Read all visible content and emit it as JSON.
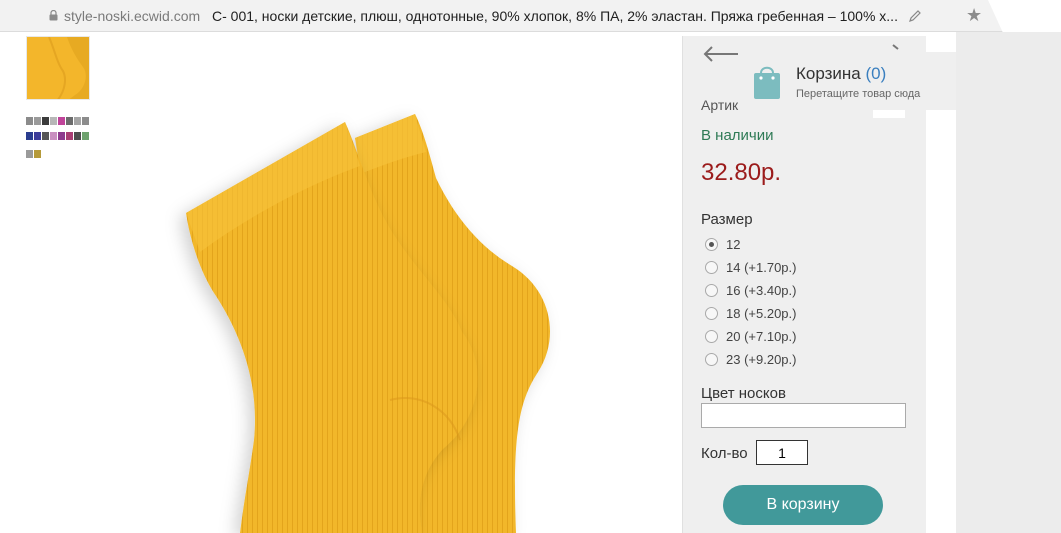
{
  "browser": {
    "url": "style-noski.ecwid.com",
    "page_title": "С- 001, носки детские, плюш, однотонные, 90% хлопок, 8% ПА, 2% эластан. Пряжа гребенная – 100% х..."
  },
  "product": {
    "article_label": "Артик",
    "stock": "В наличии",
    "price": "32.80р.",
    "size_label": "Размер",
    "sizes": [
      {
        "label": "12",
        "checked": true
      },
      {
        "label": "14 (+1.70р.)",
        "checked": false
      },
      {
        "label": "16 (+3.40р.)",
        "checked": false
      },
      {
        "label": "18 (+5.20р.)",
        "checked": false
      },
      {
        "label": "20 (+7.10р.)",
        "checked": false
      },
      {
        "label": "23 (+9.20р.)",
        "checked": false
      }
    ],
    "color_label": "Цвет носков",
    "color_value": "",
    "qty_label": "Кол-во",
    "qty_value": "1",
    "add_to_cart": "В корзину"
  },
  "cart": {
    "title": "Корзина",
    "count": "(0)",
    "hint": "Перетащите товар сюда"
  },
  "colors": {
    "accent": "#41999a",
    "price": "#9b1b1b",
    "stock": "#2e7a55",
    "sock": "#f3b62b",
    "cart_count": "#3a7fbf"
  },
  "icons": {
    "lock": "lock-icon",
    "edit": "pencil-icon",
    "star": "star-icon",
    "back": "back-arrow-icon",
    "cart": "shopping-bag-icon"
  }
}
